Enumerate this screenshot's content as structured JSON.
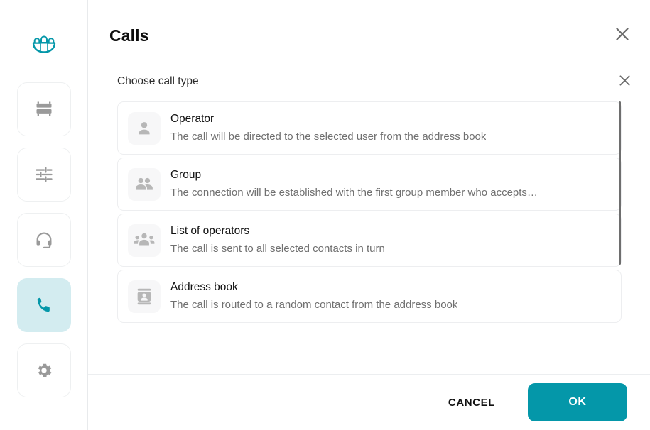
{
  "theme": {
    "accent": "#0497a9",
    "accent_soft": "#d3ecf0",
    "text_primary": "#111111",
    "text_muted": "#707070",
    "border": "#edeef0"
  },
  "sidebar": {
    "logo": {
      "icon": "people-group-icon",
      "label": "Logo"
    },
    "items": [
      {
        "icon": "server-rack-icon",
        "label": "Devices",
        "active": false
      },
      {
        "icon": "sliders-tune-icon",
        "label": "Settings Sliders",
        "active": false
      },
      {
        "icon": "headset-icon",
        "label": "Operators",
        "active": false
      },
      {
        "icon": "phone-icon",
        "label": "Calls",
        "active": true
      },
      {
        "icon": "gear-icon",
        "label": "Preferences",
        "active": false
      }
    ]
  },
  "dialog": {
    "title": "Calls",
    "close_icon": "close-icon",
    "section": {
      "label": "Choose call type",
      "close_icon": "close-icon"
    },
    "options": [
      {
        "icon": "person-icon",
        "title": "Operator",
        "description": "The call will be directed to the selected user from the address book"
      },
      {
        "icon": "two-people-icon",
        "title": "Group",
        "description": "The connection will be established with the first group member who accepts…"
      },
      {
        "icon": "three-people-icon",
        "title": "List of operators",
        "description": "The call is sent to all selected contacts in turn"
      },
      {
        "icon": "contact-card-icon",
        "title": "Address book",
        "description": "The call is routed to a random contact from the address book"
      }
    ],
    "footer": {
      "cancel_label": "CANCEL",
      "ok_label": "OK"
    }
  }
}
